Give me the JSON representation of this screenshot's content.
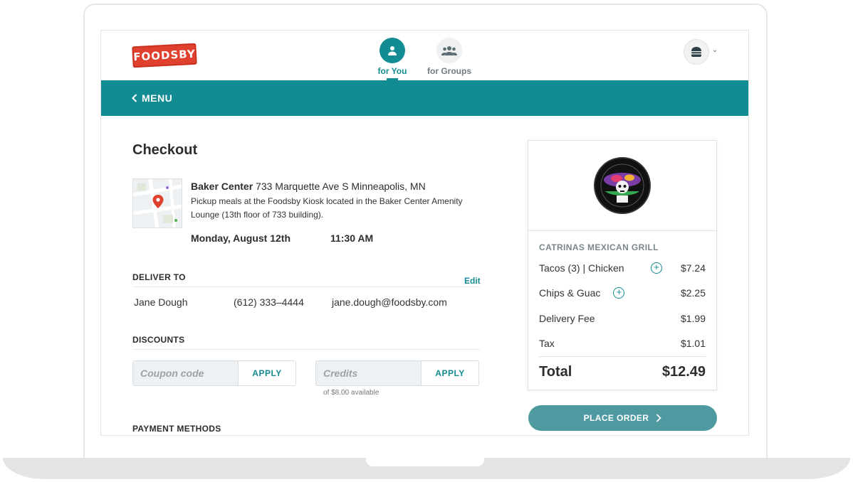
{
  "brand": {
    "logo_text": "FOODSBY",
    "accent_color": "#138b93",
    "logo_color": "#e0402e"
  },
  "nav": {
    "tabs": [
      {
        "label": "for You",
        "icon": "person-icon",
        "active": true
      },
      {
        "label": "for Groups",
        "icon": "group-icon",
        "active": false
      }
    ]
  },
  "menu_bar": {
    "back_label": "MENU"
  },
  "checkout": {
    "title": "Checkout",
    "location": {
      "name": "Baker Center",
      "address": "733 Marquette Ave S Minneapolis, MN",
      "description": "Pickup meals at the Foodsby Kiosk located in the Baker Center Amenity Lounge (13th floor of 733 building).",
      "date": "Monday, August 12th",
      "time": "11:30 AM"
    },
    "deliver_to": {
      "heading": "DELIVER TO",
      "edit_label": "Edit",
      "name": "Jane Dough",
      "phone": "(612) 333–4444",
      "email": "jane.dough@foodsby.com"
    },
    "discounts": {
      "heading": "DISCOUNTS",
      "coupon_placeholder": "Coupon code",
      "coupon_button": "APPLY",
      "credits_placeholder": "Credits",
      "credits_button": "APPLY",
      "credits_note": "of $8.00 available"
    },
    "payment": {
      "heading": "PAYMENT METHODS"
    }
  },
  "order": {
    "restaurant": "CATRINAS MEXICAN GRILL",
    "items": [
      {
        "name": "Tacos (3) | Chicken",
        "price": "$7.24",
        "has_add": true
      },
      {
        "name": "Chips & Guac",
        "price": "$2.25",
        "has_add": true
      },
      {
        "name": "Delivery Fee",
        "price": "$1.99",
        "has_add": false
      },
      {
        "name": "Tax",
        "price": "$1.01",
        "has_add": false
      }
    ],
    "total_label": "Total",
    "total_value": "$12.49",
    "place_order_label": "PLACE ORDER"
  }
}
